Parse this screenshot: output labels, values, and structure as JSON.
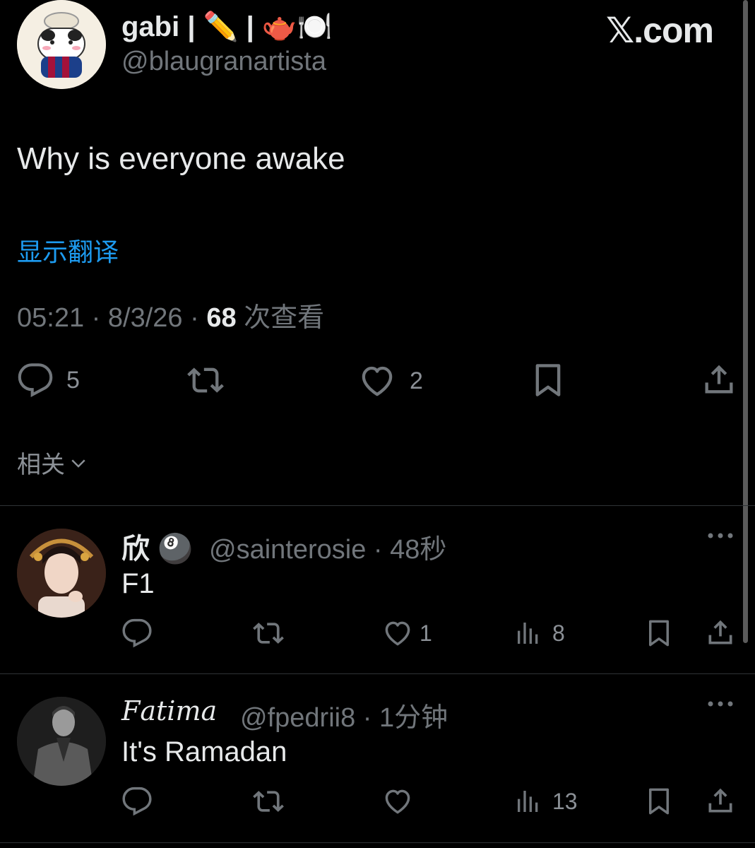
{
  "tweet": {
    "author_name": "gabi | ✏️ | 🫖🍽️",
    "author_handle": "@blaugranartista",
    "site_logo": "𝕏.com",
    "text": "Why is everyone awake",
    "translate_label": "显示翻译",
    "time": "05:21",
    "date": "8/3/26",
    "views_count": "68",
    "views_label": "次查看",
    "reply_count": "5",
    "like_count": "2",
    "related_label": "相关"
  },
  "replies": [
    {
      "name": "欣 🎱",
      "handle": "@sainterosie",
      "time": "48秒",
      "text": "F1",
      "like_count": "1",
      "views_count": "8"
    },
    {
      "name": "𝐹𝑎𝑡𝑖𝑚𝑎",
      "handle": "@fpedrii8",
      "time": "1分钟",
      "text": "It's Ramadan",
      "like_count": "",
      "views_count": "13"
    }
  ],
  "icons": [
    "reply-icon",
    "retweet-icon",
    "like-icon",
    "bookmark-icon",
    "share-icon",
    "views-icon",
    "more-icon",
    "chevron-down-icon"
  ],
  "colors": {
    "background": "#000000",
    "text": "#e7e9ea",
    "muted": "#71767b",
    "link": "#1d9bf0",
    "divider": "#2f3336"
  }
}
